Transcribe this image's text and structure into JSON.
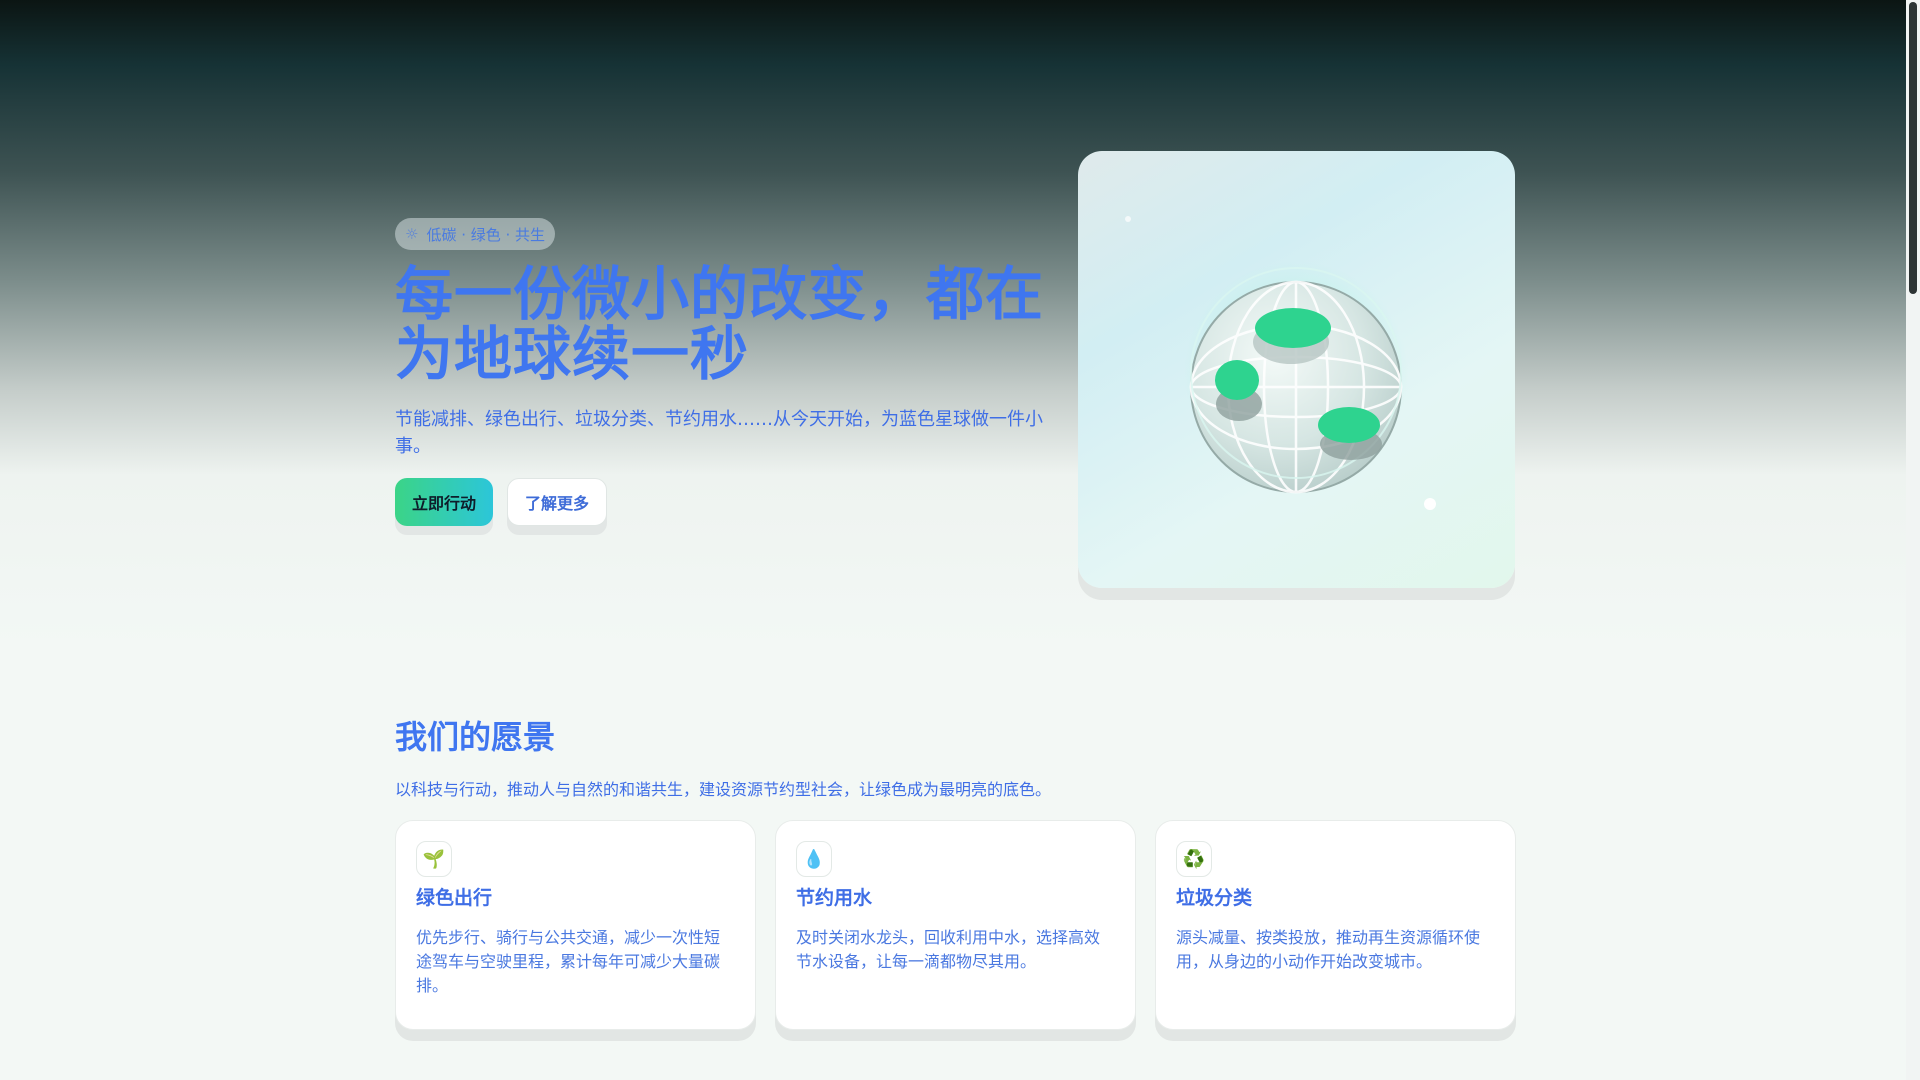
{
  "hero": {
    "tag_icon": "sparkle-icon",
    "tag": "低碳 · 绿色 · 共生",
    "title_line1": "每一份微小的改变，都在",
    "title_line2": "为地球续一秒",
    "description": "节能减排、绿色出行、垃圾分类、节约用水……从今天开始，为蓝色星球做一件小事。",
    "primary_button": "立即行动",
    "secondary_button": "了解更多"
  },
  "colors": {
    "accent_blue": "#3f76f0",
    "accent_green": "#3bd487",
    "accent_cyan": "#2cc6d9"
  },
  "vision": {
    "title": "我们的愿景",
    "description": "以科技与行动，推动人与自然的和谐共生，建设资源节约型社会，让绿色成为最明亮的底色。",
    "cards": [
      {
        "icon": "🌱",
        "icon_name": "seedling-icon",
        "title": "绿色出行",
        "text": "优先步行、骑行与公共交通，减少一次性短途驾车与空驶里程，累计每年可减少大量碳排。"
      },
      {
        "icon": "💧",
        "icon_name": "water-drop-icon",
        "title": "节约用水",
        "text": "及时关闭水龙头，回收利用中水，选择高效节水设备，让每一滴都物尽其用。"
      },
      {
        "icon": "♻️",
        "icon_name": "recycle-icon",
        "title": "垃圾分类",
        "text": "源头减量、按类投放，推动再生资源循环使用，从身边的小动作开始改变城市。"
      }
    ]
  }
}
